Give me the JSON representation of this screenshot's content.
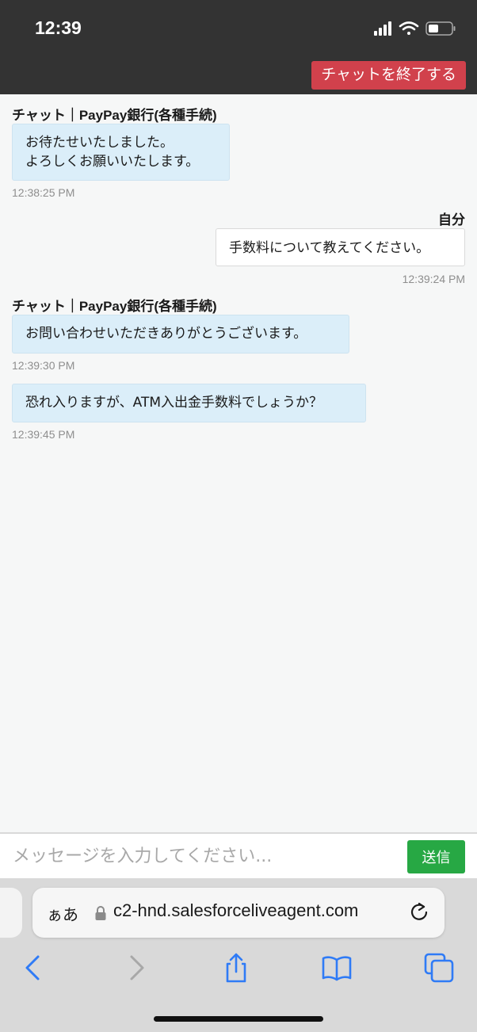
{
  "status_bar": {
    "time": "12:39"
  },
  "header": {
    "end_chat_label": "チャットを終了する"
  },
  "messages": [
    {
      "sender": "チャット｜PayPay銀行(各種手続)",
      "text": "お待たせいたしました。\nよろしくお願いいたします。",
      "time": "12:38:25 PM"
    },
    {
      "sender": "自分",
      "text": "手数料について教えてください。",
      "time": "12:39:24 PM"
    },
    {
      "sender": "チャット｜PayPay銀行(各種手続)",
      "text": "お問い合わせいただきありがとうございます。",
      "time": "12:39:30 PM"
    },
    {
      "text": "恐れ入りますが、ATM入出金手数料でしょうか？",
      "time": "12:39:45 PM"
    }
  ],
  "composer": {
    "placeholder": "メッセージを入力してください...",
    "send_label": "送信"
  },
  "browser": {
    "aa_label": "ぁあ",
    "url": "c2-hnd.salesforceliveagent.com"
  },
  "colors": {
    "header_bg": "#333333",
    "end_chat": "#d1414c",
    "agent_bubble": "#dbeef9",
    "send_button": "#27a844",
    "safari_blue": "#2f7bf6"
  },
  "icons": [
    "signal-icon",
    "wifi-icon",
    "battery-icon",
    "lock-icon",
    "reload-icon",
    "back-icon",
    "forward-icon",
    "share-icon",
    "bookmarks-icon",
    "tabs-icon"
  ]
}
